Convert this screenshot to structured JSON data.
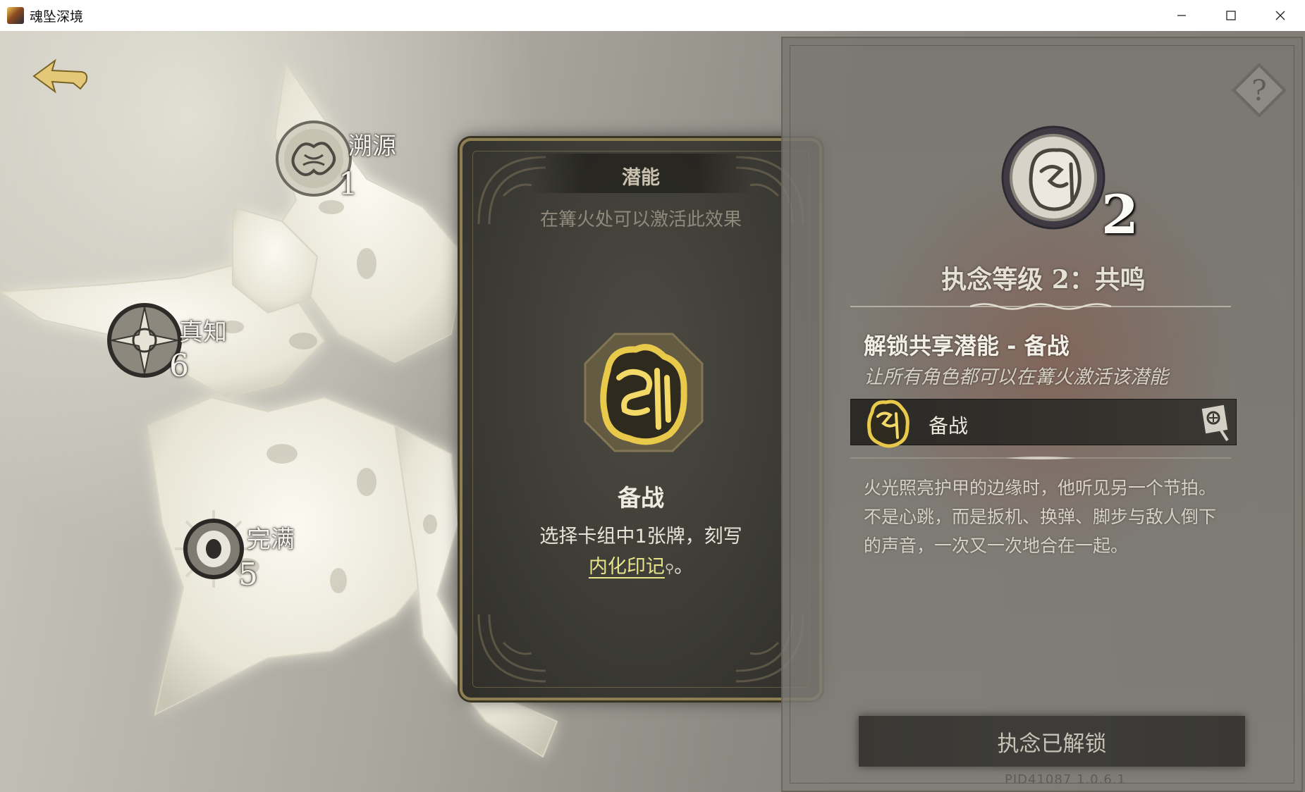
{
  "window": {
    "title": "魂坠深境",
    "controls": [
      "minimize-icon",
      "maximize-icon",
      "close-icon"
    ]
  },
  "nav": {
    "back_icon": "back-arrow-icon"
  },
  "skill_tree": {
    "nodes": [
      {
        "label": "溯源",
        "value": "1",
        "icon": "brain-sigil-icon"
      },
      {
        "label": "真知",
        "value": "6",
        "icon": "compass-star-icon"
      },
      {
        "label": "完满",
        "value": "5",
        "icon": "spiked-eye-icon"
      }
    ]
  },
  "card": {
    "title": "潜能",
    "subtitle": "在篝火处可以激活此效果",
    "icon": "battle-ready-glyph-icon",
    "name": "备战",
    "desc_prefix": "选择卡组中1张牌，刻写",
    "desc_keyword": "内化印记",
    "desc_suffix": "。"
  },
  "panel": {
    "help_icon": "help-diamond-icon",
    "level_number": "2",
    "level_title": "执念等级 2：共鸣",
    "unlock_title": "解锁共享潜能 - 备战",
    "unlock_subtitle": "让所有角色都可以在篝火激活该潜能",
    "potential_item": {
      "label": "备战",
      "icon": "battle-ready-glyph-icon",
      "action_icon": "inspect-card-icon"
    },
    "lore_lines": [
      "火光照亮护甲的边缘时，他听见另一个节拍。",
      "不是心跳，而是扳机、换弹、脚步与敌人倒下",
      "的声音，一次又一次地合在一起。"
    ],
    "unlocked_button": "执念已解锁"
  },
  "footer": {
    "version": "PID41087 1.0.6.1"
  },
  "colors": {
    "keyword": "#e7e48a",
    "card_border": "#8e7f52",
    "gold_glyph": "#e8c94a"
  }
}
